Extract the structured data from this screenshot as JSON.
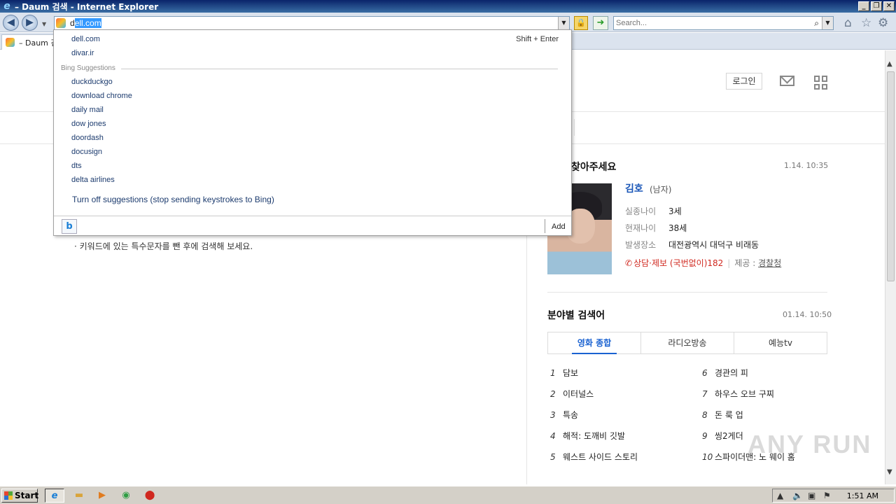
{
  "window": {
    "title": "– Daum 검색 - Internet Explorer",
    "minimize": "_",
    "restore": "❐",
    "close": "✕"
  },
  "navbar": {
    "url_prefix": "d",
    "url_selected": "ell.com",
    "search_placeholder": "Search..."
  },
  "tab": {
    "label": "– Daum 검색"
  },
  "autocomplete": {
    "history": [
      {
        "label": "dell.com",
        "hint": "Shift + Enter"
      },
      {
        "label": "divar.ir"
      }
    ],
    "section_label": "Bing Suggestions",
    "suggestions": [
      "duckduckgo",
      "download chrome",
      "daily mail",
      "dow jones",
      "doordash",
      "docusign",
      "dts",
      "delta airlines"
    ],
    "turn_off": "Turn off suggestions (stop sending keystrokes to Bing)",
    "bing_button": "b",
    "add_label": "Add"
  },
  "page": {
    "login_label": "로그인",
    "tip": "· 키워드에 있는 특수문자를 뺀 후에 검색해 보세요.",
    "missing": {
      "title": "찾아주세요",
      "time": "1.14. 10:35",
      "name": "김호",
      "gender": "(남자)",
      "rows": [
        {
          "key": "실종나이",
          "value": "3세"
        },
        {
          "key": "현재나이",
          "value": "38세"
        },
        {
          "key": "발생장소",
          "value": "대전광역시 대덕구 비래동"
        }
      ],
      "hotline": "상담·제보 (국번없이)182",
      "provider_label": "제공 :",
      "provider": "경찰청"
    },
    "category": {
      "title": "분야별 검색어",
      "time": "01.14. 10:50",
      "tabs": [
        "영화 종합",
        "라디오방송",
        "예능tv"
      ],
      "left": [
        {
          "num": "1",
          "label": "담보"
        },
        {
          "num": "2",
          "label": "이터널스"
        },
        {
          "num": "3",
          "label": "특송"
        },
        {
          "num": "4",
          "label": "해적: 도깨비 깃발"
        },
        {
          "num": "5",
          "label": "웨스트 사이드 스토리"
        }
      ],
      "right": [
        {
          "num": "6",
          "label": "경관의 피"
        },
        {
          "num": "7",
          "label": "하우스 오브 구찌"
        },
        {
          "num": "8",
          "label": "돈 룩 업"
        },
        {
          "num": "9",
          "label": "씽2게더"
        },
        {
          "num": "10",
          "label": "스파이더맨: 노 웨이 홈"
        }
      ]
    },
    "watermark": "ANY RUN"
  },
  "taskbar": {
    "start_label": "Start",
    "clock": "1:51 AM"
  },
  "icons": {
    "back": "back-icon",
    "forward": "forward-icon",
    "lock": "lock-icon",
    "go": "go-icon",
    "home": "home-icon",
    "favorites": "star-icon",
    "settings": "gear-icon"
  }
}
